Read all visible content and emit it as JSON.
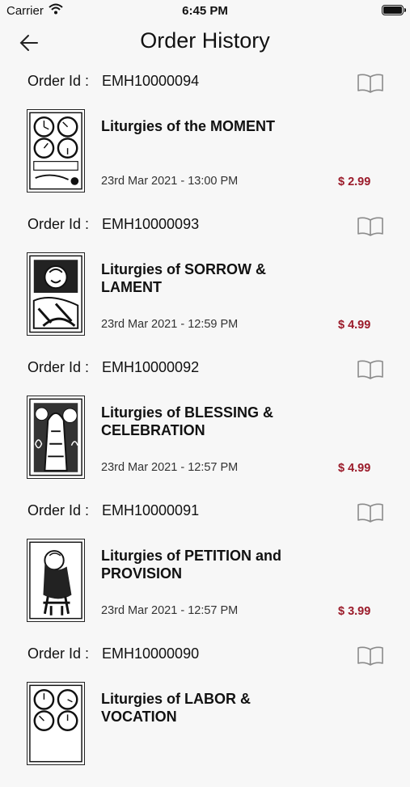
{
  "status": {
    "carrier": "Carrier",
    "time": "6:45 PM"
  },
  "nav": {
    "title": "Order History",
    "back_icon": "arrow-left-icon"
  },
  "order_id_label": "Order Id :",
  "orders": [
    {
      "id": "EMH10000094",
      "title": "Liturgies of the MOMENT",
      "date": "23rd Mar 2021 - 13:00 PM",
      "price": "$ 2.99"
    },
    {
      "id": "EMH10000093",
      "title": "Liturgies of SORROW & LAMENT",
      "date": "23rd Mar 2021 - 12:59 PM",
      "price": "$ 4.99"
    },
    {
      "id": "EMH10000092",
      "title": "Liturgies of BLESSING & CELEBRATION",
      "date": "23rd Mar 2021 - 12:57 PM",
      "price": "$ 4.99"
    },
    {
      "id": "EMH10000091",
      "title": "Liturgies of PETITION and PROVISION",
      "date": "23rd Mar 2021 - 12:57 PM",
      "price": "$ 3.99"
    },
    {
      "id": "EMH10000090",
      "title": "Liturgies of LABOR & VOCATION",
      "date": "",
      "price": ""
    }
  ],
  "colors": {
    "price": "#9b1b2a",
    "background": "#f7f7f7"
  }
}
